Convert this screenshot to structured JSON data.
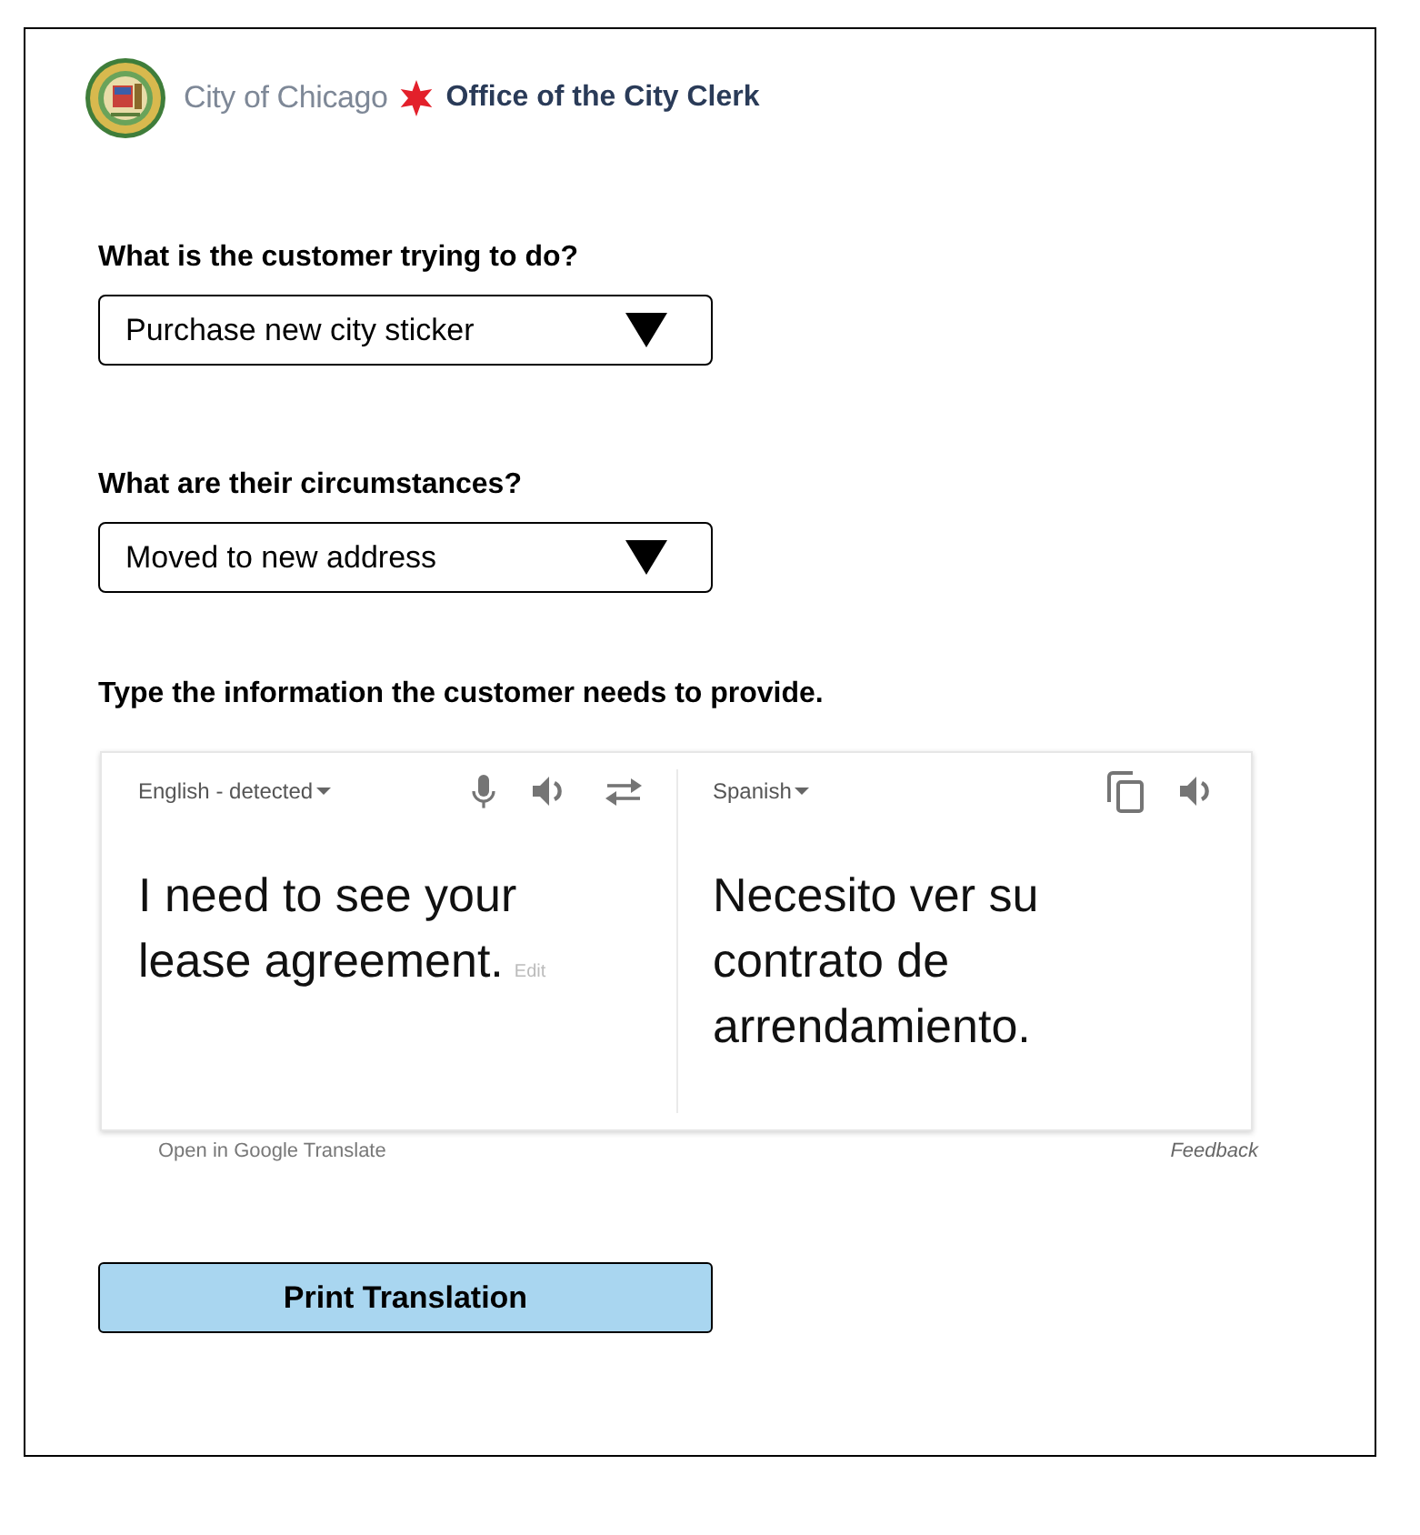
{
  "header": {
    "city_name": "City of Chicago",
    "office_name": "Office of the City Clerk"
  },
  "questions": [
    {
      "label": "What is the customer trying to do?",
      "value": "Purchase new city sticker"
    },
    {
      "label": "What are their circumstances?",
      "value": "Moved to new address"
    }
  ],
  "translator": {
    "prompt": "Type the information the customer needs to provide.",
    "source": {
      "language": "English - detected",
      "text": "I need to see your lease agreement.",
      "edit_link": "Edit"
    },
    "target": {
      "language": "Spanish",
      "text": "Necesito ver su contrato de arrendamiento."
    },
    "open_link": "Open in Google Translate",
    "feedback_link": "Feedback"
  },
  "print_button": "Print Translation"
}
